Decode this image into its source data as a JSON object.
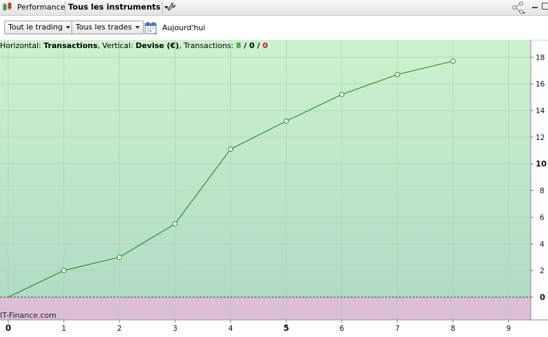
{
  "topbar": {
    "performance_label": "Performance",
    "instruments_label": "Tous les instruments"
  },
  "toolbar": {
    "trading_filter": "Tout le trading",
    "trades_filter": "Tous les trades",
    "date_label": "Aujourd'hui"
  },
  "chart_info": {
    "horizontal_prefix": "Horizontal: ",
    "horizontal_value": "Transactions",
    "vertical_prefix": ", Vertical: ",
    "vertical_value": "Devise (€)",
    "transactions_prefix": ", Transactions: ",
    "count_total": "8",
    "sep1": " / ",
    "count_mid": "0",
    "sep2": " / ",
    "count_loss": "0"
  },
  "watermark": "IT-Finance.com",
  "colors": {
    "line": "#2e8b2e",
    "positive_bg_top": "#cdf2cd",
    "positive_bg_bottom": "#b0dcc6",
    "negative_bg": "#dcbfd6",
    "count_green": "#1f9a1f",
    "count_red": "#d01010"
  },
  "chart_data": {
    "type": "line",
    "x": [
      0,
      1,
      2,
      3,
      4,
      5,
      6,
      7,
      8
    ],
    "values": [
      0,
      2.0,
      3.0,
      5.5,
      11.1,
      13.2,
      15.2,
      16.7,
      17.7
    ],
    "xlim": [
      0,
      9.4
    ],
    "ylim": [
      -1.7,
      19.3
    ],
    "x_ticks": [
      "0",
      "1",
      "2",
      "3",
      "4",
      "5",
      "6",
      "7",
      "8",
      "9"
    ],
    "y_ticks": [
      "0",
      "2",
      "4",
      "6",
      "8",
      "10",
      "12",
      "14",
      "16",
      "18"
    ],
    "xlabel": "Transactions",
    "ylabel": "Devise (€)",
    "grid": true
  }
}
